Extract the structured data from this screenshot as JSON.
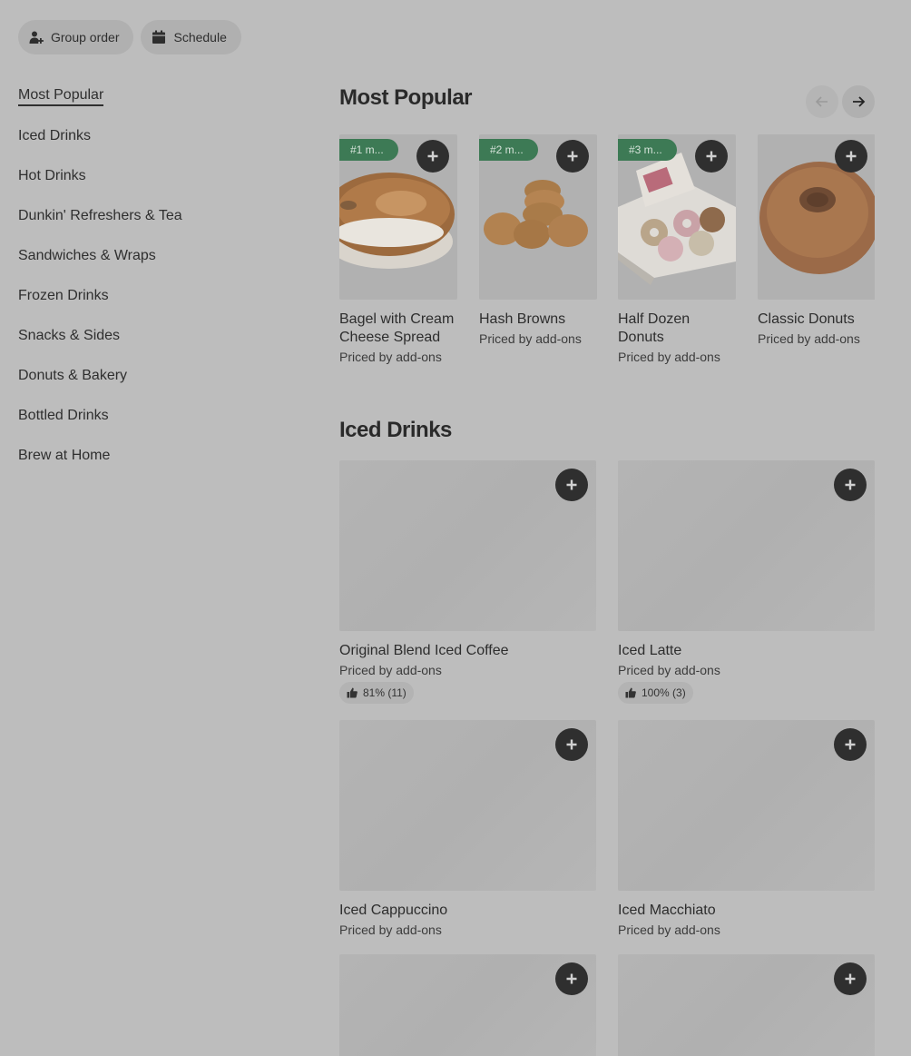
{
  "top_buttons": {
    "group_order": "Group order",
    "schedule": "Schedule"
  },
  "sidebar": {
    "items": [
      {
        "label": "Most Popular",
        "active": true
      },
      {
        "label": "Iced Drinks"
      },
      {
        "label": "Hot Drinks"
      },
      {
        "label": "Dunkin' Refreshers & Tea"
      },
      {
        "label": "Sandwiches & Wraps"
      },
      {
        "label": "Frozen Drinks"
      },
      {
        "label": "Snacks & Sides"
      },
      {
        "label": "Donuts & Bakery"
      },
      {
        "label": "Bottled Drinks"
      },
      {
        "label": "Brew at Home"
      }
    ]
  },
  "most_popular": {
    "title": "Most Popular",
    "items": [
      {
        "badge": "#1 m...",
        "name": "Bagel with Cream Cheese Spread",
        "price": "Priced by add-ons"
      },
      {
        "badge": "#2 m...",
        "name": "Hash Browns",
        "price": "Priced by add-ons"
      },
      {
        "badge": "#3 m...",
        "name": "Half Dozen Donuts",
        "price": "Priced by add-ons"
      },
      {
        "name": "Classic Donuts",
        "price": "Priced by add-ons"
      }
    ]
  },
  "iced_drinks": {
    "title": "Iced Drinks",
    "items": [
      {
        "name": "Original Blend Iced Coffee",
        "price": "Priced by add-ons",
        "rating": "81% (11)"
      },
      {
        "name": "Iced Latte",
        "price": "Priced by add-ons",
        "rating": "100% (3)"
      },
      {
        "name": "Iced Cappuccino",
        "price": "Priced by add-ons"
      },
      {
        "name": "Iced Macchiato",
        "price": "Priced by add-ons"
      }
    ]
  },
  "colors": {
    "background": "#bdbdbd",
    "badge_green": "#3d7a55",
    "add_button": "#2f2f2f"
  }
}
